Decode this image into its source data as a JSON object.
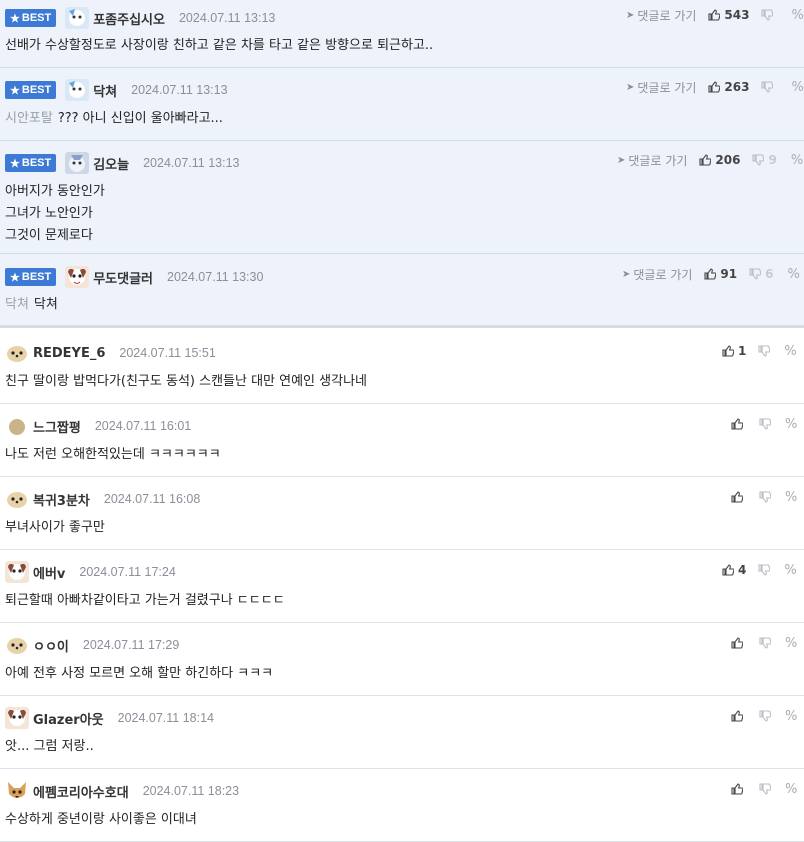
{
  "colors": {
    "best_bg": "#eef2fb",
    "badge": "#3d7ad6",
    "divider": "#dfe3ea"
  },
  "icons": {
    "best": "star-icon",
    "reply": "arrow-icon",
    "up": "thumbs-up-icon",
    "down": "thumbs-down-icon",
    "link": "link-icon"
  },
  "best_label": "BEST",
  "reply_label": "댓글로 가기",
  "best_comments": [
    {
      "nick": "포좀주십시오",
      "date": "2024.07.11 13:13",
      "lines": [
        "선배가 수상할정도로 사장이랑 친하고 같은 차를 타고 같은 방향으로 퇴근하고.."
      ],
      "prefix": "",
      "up": "543",
      "down": ""
    },
    {
      "nick": "닥쳐",
      "date": "2024.07.11 13:13",
      "lines": [
        "??? 아니 신입이 울아빠라고..."
      ],
      "prefix": "시안포탈",
      "up": "263",
      "down": ""
    },
    {
      "nick": "김오늘",
      "date": "2024.07.11 13:13",
      "lines": [
        "아버지가 동안인가",
        "그녀가 노안인가",
        "그것이 문제로다"
      ],
      "prefix": "",
      "up": "206",
      "down": "9"
    },
    {
      "nick": "무도댓글러",
      "date": "2024.07.11 13:30",
      "lines": [
        "닥쳐"
      ],
      "prefix": "닥쳐",
      "up": "91",
      "down": "6"
    }
  ],
  "comments": [
    {
      "nick": "REDEYE_6",
      "date": "2024.07.11 15:51",
      "text": "친구 딸이랑 밥먹다가(친구도 동석) 스캔들난 대만 연예인 생각나네",
      "up": "1"
    },
    {
      "nick": "느그짭평",
      "date": "2024.07.11 16:01",
      "text": "나도 저런 오해한적있는데 ㅋㅋㅋㅋㅋㅋ",
      "up": ""
    },
    {
      "nick": "복귀3분차",
      "date": "2024.07.11 16:08",
      "text": "부녀사이가 좋구만",
      "up": ""
    },
    {
      "nick": "에버v",
      "date": "2024.07.11 17:24",
      "text": "퇴근할때 아빠차같이타고 가는거 걸렸구나 ㄷㄷㄷㄷ",
      "up": "4"
    },
    {
      "nick": "ㅇㅇ이",
      "date": "2024.07.11 17:29",
      "text": "아예 전후 사정 모르면 오해 할만 하긴하다 ㅋㅋㅋ",
      "up": ""
    },
    {
      "nick": "Glazer아웃",
      "date": "2024.07.11 18:14",
      "text": "앗... 그럼 저랑..",
      "up": ""
    },
    {
      "nick": "에펨코리아수호대",
      "date": "2024.07.11 18:23",
      "text": "수상하게 중년이랑 사이좋은 이대녀",
      "up": ""
    }
  ]
}
